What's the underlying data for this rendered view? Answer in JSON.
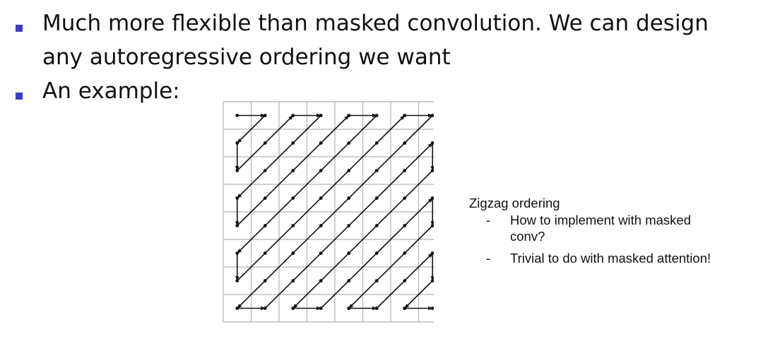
{
  "bullets": [
    {
      "line1": "Much more flexible than masked convolution. We can design",
      "line2": "any autoregressive ordering we want"
    },
    {
      "line1": "An example:"
    }
  ],
  "figure": {
    "grid_rows": 8,
    "grid_cols": 8,
    "ordering": "zigzag",
    "grid_color": "#b5b5b5",
    "arrow_color": "#111111"
  },
  "caption": {
    "title": "Zigzag ordering",
    "items": [
      {
        "dash": "-",
        "line1": "How to implement with masked",
        "line2": "conv?"
      },
      {
        "dash": "-",
        "line1": "Trivial to do with masked attention!"
      }
    ]
  },
  "colors": {
    "bullet": "#3b3bc7",
    "text": "#111111"
  }
}
